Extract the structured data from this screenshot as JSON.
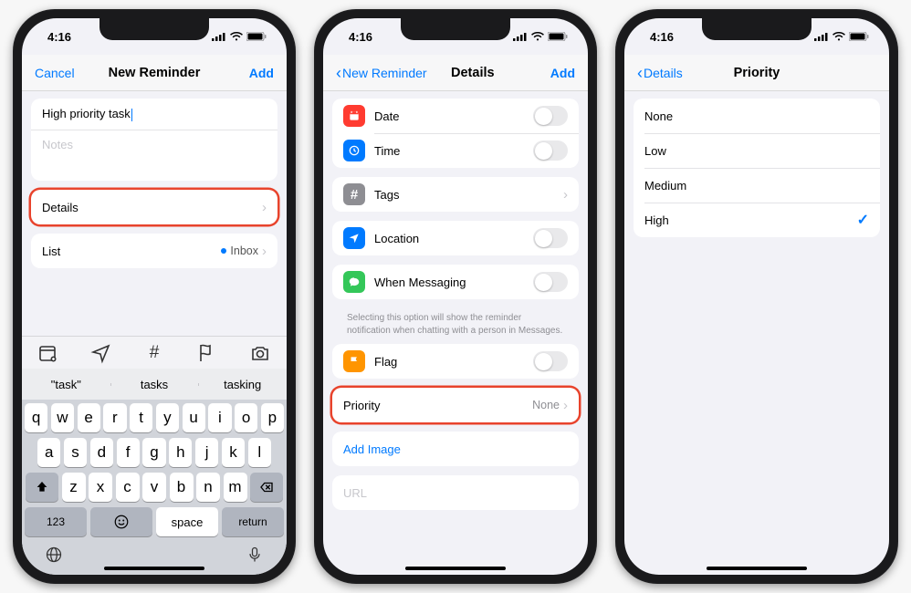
{
  "status": {
    "time": "4:16"
  },
  "screen1": {
    "nav": {
      "left": "Cancel",
      "title": "New Reminder",
      "right": "Add"
    },
    "input": {
      "title_value": "High priority task",
      "notes_placeholder": "Notes"
    },
    "details_label": "Details",
    "list_label": "List",
    "list_value": "Inbox",
    "suggestions": [
      "\"task\"",
      "tasks",
      "tasking"
    ],
    "keys": {
      "row1": [
        "q",
        "w",
        "e",
        "r",
        "t",
        "y",
        "u",
        "i",
        "o",
        "p"
      ],
      "row2": [
        "a",
        "s",
        "d",
        "f",
        "g",
        "h",
        "j",
        "k",
        "l"
      ],
      "row3": [
        "z",
        "x",
        "c",
        "v",
        "b",
        "n",
        "m"
      ],
      "num": "123",
      "space": "space",
      "return": "return"
    }
  },
  "screen2": {
    "nav": {
      "back": "New Reminder",
      "title": "Details",
      "right": "Add"
    },
    "rows": {
      "date": "Date",
      "time": "Time",
      "tags": "Tags",
      "location": "Location",
      "messaging": "When Messaging",
      "flag": "Flag",
      "priority": "Priority",
      "priority_value": "None",
      "add_image": "Add Image",
      "url_placeholder": "URL"
    },
    "messaging_note": "Selecting this option will show the reminder notification when chatting with a person in Messages."
  },
  "screen3": {
    "nav": {
      "back": "Details",
      "title": "Priority"
    },
    "options": [
      "None",
      "Low",
      "Medium",
      "High"
    ],
    "selected_index": 3
  }
}
